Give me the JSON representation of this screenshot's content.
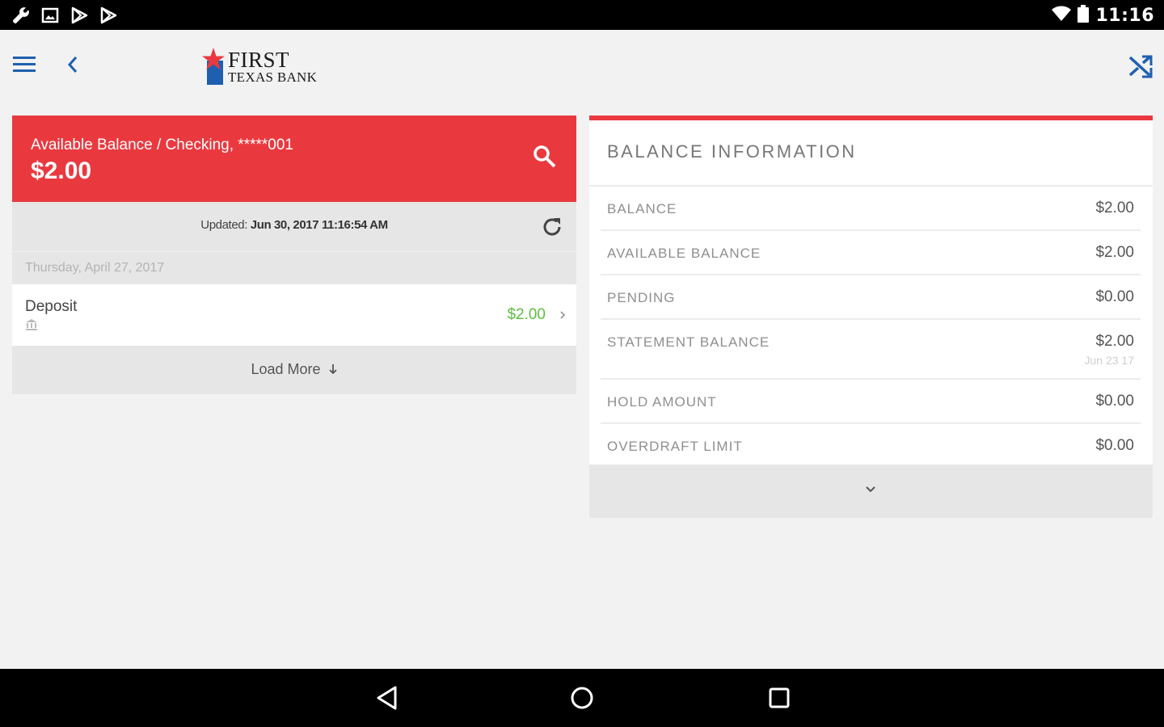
{
  "status_bar": {
    "time": "11:16",
    "left_icons": [
      "wrench-icon",
      "image-icon",
      "play-store-icon",
      "play-store-icon"
    ],
    "right_icons": [
      "wifi-icon",
      "battery-icon"
    ]
  },
  "header": {
    "logo_line1": "FIRST",
    "logo_line2": "TEXAS BANK",
    "accent_color": "#e9393f",
    "brand_blue": "#1f5fb0"
  },
  "balance_card": {
    "label": "Available Balance / Checking, *****001",
    "amount": "$2.00"
  },
  "updated": {
    "prefix": "Updated: ",
    "timestamp": "Jun 30, 2017 11:16:54 AM"
  },
  "transactions": {
    "date_header": "Thursday, April 27, 2017",
    "items": [
      {
        "description": "Deposit",
        "amount": "$2.00"
      }
    ],
    "load_more": "Load More"
  },
  "balance_info": {
    "title": "BALANCE INFORMATION",
    "rows": [
      {
        "label": "BALANCE",
        "value": "$2.00"
      },
      {
        "label": "AVAILABLE BALANCE",
        "value": "$2.00"
      },
      {
        "label": "PENDING",
        "value": "$0.00"
      },
      {
        "label": "STATEMENT BALANCE",
        "value": "$2.00",
        "sub": "Jun 23 17"
      },
      {
        "label": "HOLD AMOUNT",
        "value": "$0.00"
      },
      {
        "label": "OVERDRAFT LIMIT",
        "value": "$0.00"
      }
    ]
  }
}
